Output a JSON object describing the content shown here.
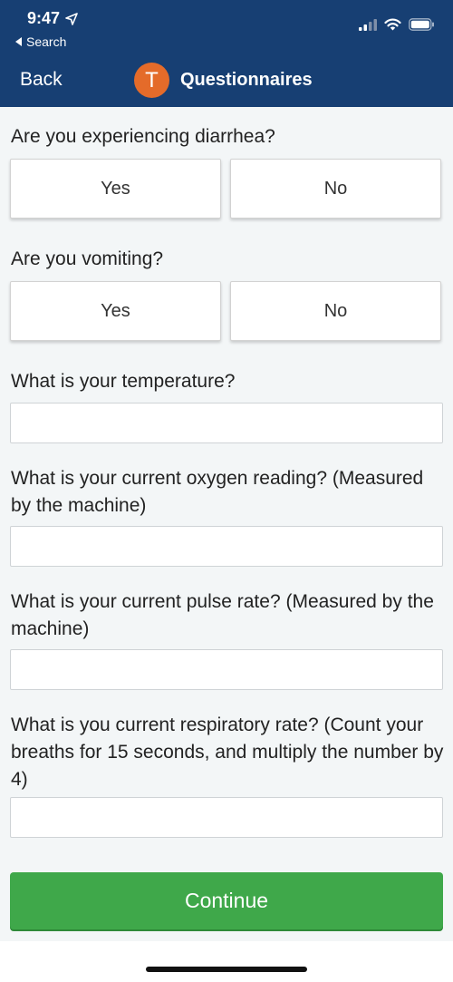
{
  "status_bar": {
    "time": "9:47",
    "back_app": "Search",
    "icons": [
      "location-arrow-icon",
      "cellular-signal-icon",
      "wifi-icon",
      "battery-icon"
    ]
  },
  "nav": {
    "back_label": "Back",
    "avatar_letter": "T",
    "title": "Questionnaires",
    "avatar_color": "#e46b2a",
    "bar_color": "#173f73"
  },
  "questions": {
    "diarrhea": {
      "label": "Are you experiencing diarrhea?",
      "yes": "Yes",
      "no": "No"
    },
    "vomiting": {
      "label": "Are you vomiting?",
      "yes": "Yes",
      "no": "No"
    },
    "temperature": {
      "label": "What is your temperature?",
      "value": ""
    },
    "oxygen": {
      "label": "What is your current oxygen reading? (Measured by the machine)",
      "value": ""
    },
    "pulse": {
      "label": "What is your current pulse rate? (Measured by the machine)",
      "value": ""
    },
    "respiratory": {
      "label": "What is you current respiratory rate? (Count your breaths for 15 seconds, and multiply the number by 4)",
      "value": ""
    }
  },
  "continue_label": "Continue",
  "colors": {
    "continue": "#3fa84a",
    "background": "#f3f6f7"
  }
}
